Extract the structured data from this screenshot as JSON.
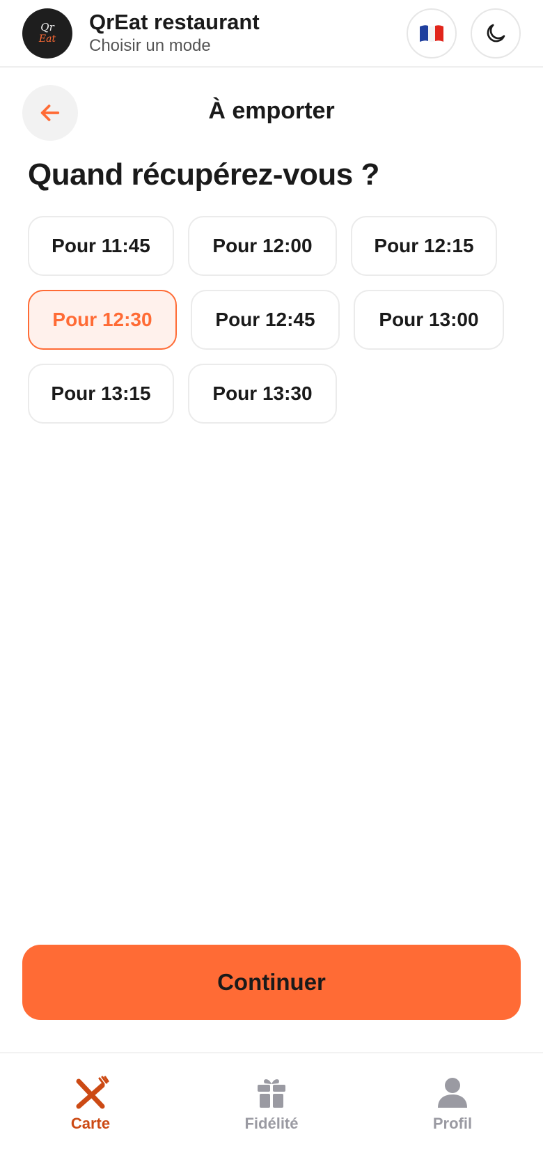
{
  "header": {
    "logo_text_top": "Qr",
    "logo_text_bottom": "Eat",
    "title": "QrEat restaurant",
    "subtitle": "Choisir un mode",
    "language_flag": "🇫🇷",
    "theme_icon": "moon-icon"
  },
  "page": {
    "back_icon": "arrow-left-icon",
    "title": "À emporter",
    "question": "Quand récupérez-vous ?"
  },
  "slots": [
    {
      "label": "Pour 11:45",
      "selected": false
    },
    {
      "label": "Pour 12:00",
      "selected": false
    },
    {
      "label": "Pour 12:15",
      "selected": false
    },
    {
      "label": "Pour 12:30",
      "selected": true
    },
    {
      "label": "Pour 12:45",
      "selected": false
    },
    {
      "label": "Pour 13:00",
      "selected": false
    },
    {
      "label": "Pour 13:15",
      "selected": false
    },
    {
      "label": "Pour 13:30",
      "selected": false
    }
  ],
  "continue_label": "Continuer",
  "nav": [
    {
      "label": "Carte",
      "icon": "utensils-icon",
      "active": true
    },
    {
      "label": "Fidélité",
      "icon": "gift-icon",
      "active": false
    },
    {
      "label": "Profil",
      "icon": "user-icon",
      "active": false
    }
  ],
  "colors": {
    "accent": "#ff6b35",
    "accent_dark": "#cc4a14",
    "selected_bg": "#fff1ec",
    "muted": "#9a9aa2"
  }
}
